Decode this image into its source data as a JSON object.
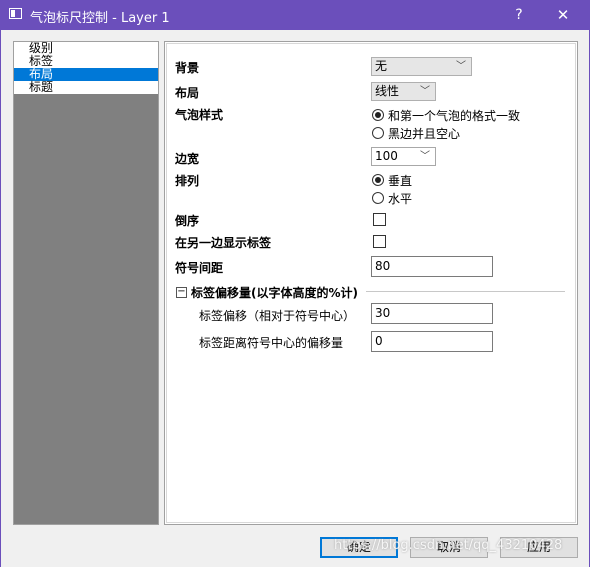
{
  "window": {
    "title": "气泡标尺控制 - Layer 1",
    "help_label": "?",
    "close_label": "✕"
  },
  "nav": {
    "items": [
      "级别",
      "标签",
      "布局",
      "标题"
    ],
    "selected": "布局"
  },
  "form": {
    "background_label": "背景",
    "background_value": "无",
    "layout_label": "布局",
    "layout_value": "线性",
    "bubble_style_label": "气泡样式",
    "bubble_style_options": [
      "和第一个气泡的格式一致",
      "黑边并且空心"
    ],
    "bubble_style_selected": "和第一个气泡的格式一致",
    "margin_label": "边宽",
    "margin_value": "100",
    "arrange_label": "排列",
    "arrange_options": [
      "垂直",
      "水平"
    ],
    "arrange_selected": "垂直",
    "reverse_label": "倒序",
    "reverse_checked": false,
    "other_side_label": "在另一边显示标签",
    "other_side_checked": false,
    "symbol_spacing_label": "符号间距",
    "symbol_spacing_value": "80",
    "offset_group_label": "标签偏移量(以字体高度的%计)",
    "offset_group_toggle": "−",
    "offset_label": "标签偏移（相对于符号中心）",
    "offset_value": "30",
    "distance_label": "标签距离符号中心的偏移量",
    "distance_value": "0"
  },
  "footer": {
    "ok_label": "确定",
    "cancel_label": "取消",
    "apply_label": "应用"
  },
  "watermark": "https://blog.csdn.net/qq_43210428"
}
